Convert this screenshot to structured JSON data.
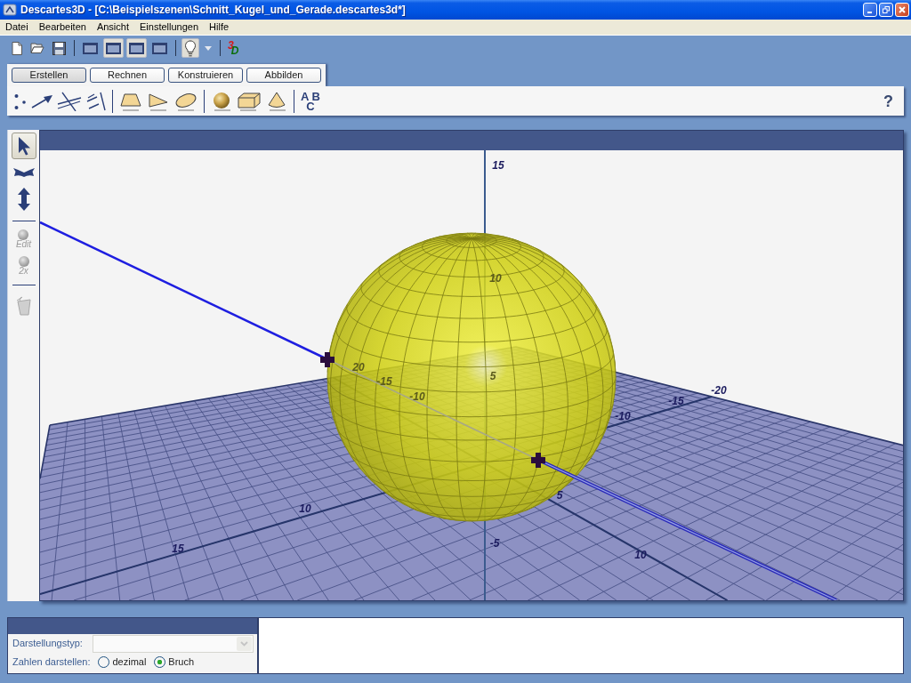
{
  "window": {
    "title": "Descartes3D - [C:\\Beispielszenen\\Schnitt_Kugel_und_Gerade.descartes3d*]",
    "controls": [
      {
        "kind": "minimize"
      },
      {
        "kind": "restore"
      },
      {
        "kind": "close"
      }
    ]
  },
  "menu": [
    "Datei",
    "Bearbeiten",
    "Ansicht",
    "Einstellungen",
    "Hilfe"
  ],
  "toolbar": [
    {
      "kind": "new"
    },
    {
      "kind": "open"
    },
    {
      "kind": "save"
    },
    {
      "kind": "separator"
    },
    {
      "kind": "view",
      "pressed": false
    },
    {
      "kind": "view",
      "pressed": true
    },
    {
      "kind": "view",
      "pressed": true
    },
    {
      "kind": "view",
      "pressed": false
    },
    {
      "kind": "separator"
    },
    {
      "kind": "light",
      "pressed": true
    },
    {
      "kind": "dropdown"
    },
    {
      "kind": "separator"
    },
    {
      "kind": "logo",
      "text": "3D"
    }
  ],
  "mode_tabs": [
    {
      "label": "Erstellen",
      "selected": true
    },
    {
      "label": "Rechnen",
      "selected": false
    },
    {
      "label": "Konstruieren",
      "selected": false
    },
    {
      "label": "Abbilden",
      "selected": false
    }
  ],
  "tools": [
    {
      "kind": "points"
    },
    {
      "kind": "vector"
    },
    {
      "kind": "lines"
    },
    {
      "kind": "skew-lines"
    },
    {
      "kind": "separator"
    },
    {
      "kind": "polygon"
    },
    {
      "kind": "triangle"
    },
    {
      "kind": "ellipse"
    },
    {
      "kind": "separator"
    },
    {
      "kind": "sphere"
    },
    {
      "kind": "cuboid"
    },
    {
      "kind": "cone"
    },
    {
      "kind": "separator"
    },
    {
      "kind": "text",
      "lines": [
        "A B",
        "C"
      ]
    }
  ],
  "help": "?",
  "side_tools": [
    {
      "kind": "pointer",
      "selected": true
    },
    {
      "kind": "rotate",
      "selected": false
    },
    {
      "kind": "move",
      "selected": false
    },
    {
      "kind": "separator"
    },
    {
      "kind": "toggle",
      "label": "Edit",
      "disabled": true
    },
    {
      "kind": "toggle",
      "label": "2x",
      "disabled": true
    },
    {
      "kind": "separator"
    },
    {
      "kind": "delete",
      "disabled": true
    }
  ],
  "scene": {
    "axis_labels": [
      {
        "text": "15",
        "faint": false
      },
      {
        "text": "10",
        "faint": true
      },
      {
        "text": "5",
        "faint": true
      },
      {
        "text": "-5",
        "faint": false
      },
      {
        "text": "20",
        "faint": true
      },
      {
        "text": "-15",
        "faint": true
      },
      {
        "text": "-10",
        "faint": true
      },
      {
        "text": "5",
        "faint": false
      },
      {
        "text": "10",
        "faint": false
      },
      {
        "text": "-10",
        "faint": false
      },
      {
        "text": "-15",
        "faint": false
      },
      {
        "text": "-20",
        "faint": false
      },
      {
        "text": "10",
        "faint": false
      },
      {
        "text": "15",
        "faint": false
      }
    ]
  },
  "properties": {
    "type_label": "Darstellungstyp:",
    "type_select": {
      "disabled": true
    },
    "number_label": "Zahlen darstellen:",
    "number_options": [
      {
        "label": "dezimal",
        "selected": false
      },
      {
        "label": "Bruch",
        "selected": true
      }
    ]
  }
}
